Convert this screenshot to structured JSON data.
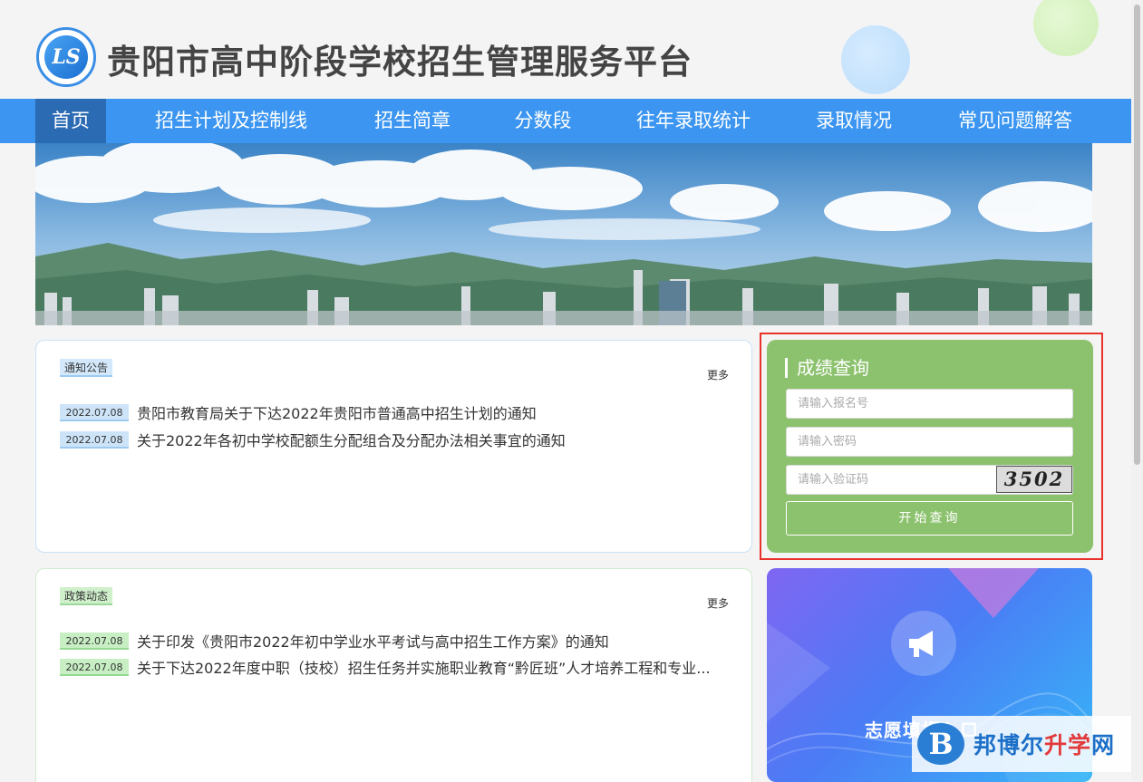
{
  "header": {
    "logo_text": "LS",
    "site_title": "贵阳市高中阶段学校招生管理服务平台"
  },
  "nav": {
    "items": [
      {
        "label": "首页",
        "active": true
      },
      {
        "label": "招生计划及控制线",
        "active": false
      },
      {
        "label": "招生简章",
        "active": false
      },
      {
        "label": "分数段",
        "active": false
      },
      {
        "label": "往年录取统计",
        "active": false
      },
      {
        "label": "录取情况",
        "active": false
      },
      {
        "label": "常见问题解答",
        "active": false
      }
    ]
  },
  "notices": {
    "tag": "通知公告",
    "more": "更多",
    "items": [
      {
        "date": "2022.07.08",
        "title": "贵阳市教育局关于下达2022年贵阳市普通高中招生计划的通知"
      },
      {
        "date": "2022.07.08",
        "title": "关于2022年各初中学校配额生分配组合及分配办法相关事宜的通知"
      }
    ]
  },
  "policy": {
    "tag": "政策动态",
    "more": "更多",
    "items": [
      {
        "date": "2022.07.08",
        "title": "关于印发《贵阳市2022年初中学业水平考试与高中招生工作方案》的通知"
      },
      {
        "date": "2022.07.08",
        "title": "关于下达2022年度中职（技校）招生任务并实施职业教育“黔匠班”人才培养工程和专业..."
      }
    ]
  },
  "score_query": {
    "title": "成绩查询",
    "reg_placeholder": "请输入报名号",
    "password_placeholder": "请输入密码",
    "captcha_placeholder": "请输入验证码",
    "captcha_text": "3502",
    "submit_label": "开始查询"
  },
  "volunteer": {
    "title": "志愿填报入口"
  },
  "watermark": {
    "logo": "B",
    "text_main": "邦博尔",
    "text_accent": "升学",
    "text_tail": "网"
  },
  "colors": {
    "nav_bg": "#3c96f1",
    "nav_active": "#2b6bb4",
    "query_bg": "#8cc26e",
    "highlight_border": "#e8322a"
  }
}
